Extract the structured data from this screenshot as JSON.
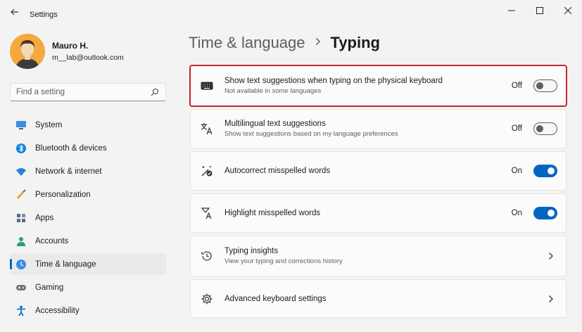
{
  "window": {
    "title": "Settings",
    "controls": [
      "minimize-icon",
      "maximize-icon",
      "close-icon"
    ]
  },
  "profile": {
    "name": "Mauro H.",
    "email": "m__lab@outlook.com"
  },
  "search": {
    "placeholder": "Find a setting",
    "icon": "search-icon"
  },
  "nav": {
    "items": [
      {
        "label": "System",
        "icon": "monitor-icon"
      },
      {
        "label": "Bluetooth & devices",
        "icon": "bluetooth-icon"
      },
      {
        "label": "Network & internet",
        "icon": "wifi-icon"
      },
      {
        "label": "Personalization",
        "icon": "brush-icon"
      },
      {
        "label": "Apps",
        "icon": "apps-icon"
      },
      {
        "label": "Accounts",
        "icon": "person-icon"
      },
      {
        "label": "Time & language",
        "icon": "globe-clock-icon",
        "active": true
      },
      {
        "label": "Gaming",
        "icon": "gamepad-icon"
      },
      {
        "label": "Accessibility",
        "icon": "accessibility-icon"
      }
    ]
  },
  "header": {
    "parent": "Time & language",
    "current": "Typing"
  },
  "settings": [
    {
      "title": "Show text suggestions when typing on the physical keyboard",
      "subtitle": "Not available in some languages",
      "state": "Off",
      "icon": "keyboard-icon",
      "highlighted": true
    },
    {
      "title": "Multilingual text suggestions",
      "subtitle": "Show text suggestions based on my language preferences",
      "state": "Off",
      "icon": "translate-icon"
    },
    {
      "title": "Autocorrect misspelled words",
      "state": "On",
      "icon": "autocorrect-icon"
    },
    {
      "title": "Highlight misspelled words",
      "state": "On",
      "icon": "highlight-text-icon"
    },
    {
      "title": "Typing insights",
      "subtitle": "View your typing and corrections history",
      "icon": "history-icon"
    },
    {
      "title": "Advanced keyboard settings",
      "icon": "gear-icon"
    }
  ],
  "colors": {
    "accent": "#0067c0",
    "highlight_border": "#c4262e",
    "background": "#f3f3f3",
    "card": "#fbfbfb"
  }
}
